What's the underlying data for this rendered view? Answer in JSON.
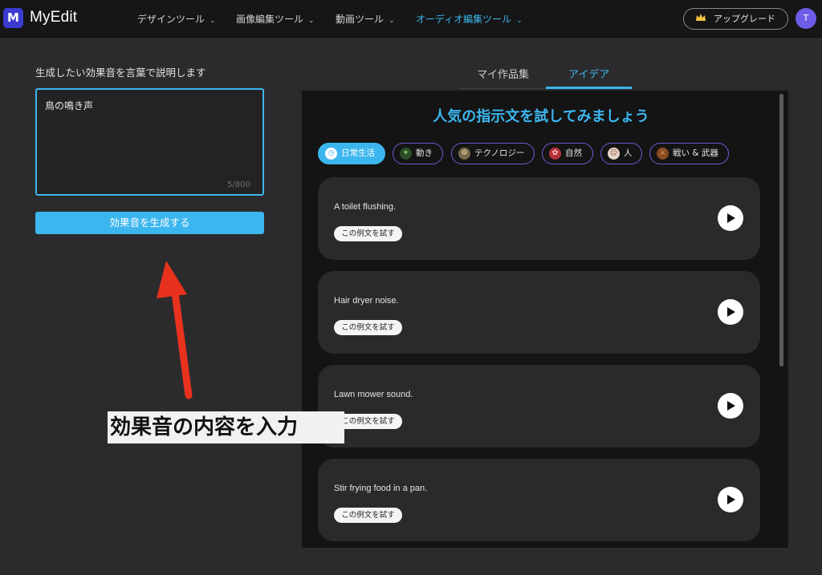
{
  "header": {
    "brand": "MyEdit",
    "nav": [
      {
        "label": "デザインツール"
      },
      {
        "label": "画像編集ツール"
      },
      {
        "label": "動画ツール"
      },
      {
        "label": "オーディオ編集ツール"
      }
    ],
    "upgrade_label": "アップグレード",
    "avatar_initial": "T",
    "logo_letter": "M"
  },
  "left": {
    "prompt_label": "生成したい効果音を言葉で説明します",
    "textarea_value": "鳥の鳴き声",
    "char_counter": "5/800",
    "generate_label": "効果音を生成する"
  },
  "annotation": {
    "caption": "効果音の内容を入力"
  },
  "tabs": [
    {
      "label": "マイ作品集"
    },
    {
      "label": "アイデア"
    }
  ],
  "ideas": {
    "title": "人気の指示文を試してみましょう",
    "categories": [
      {
        "label": "日常生活",
        "icon": "clock-icon"
      },
      {
        "label": "動き",
        "icon": "comet-icon"
      },
      {
        "label": "テクノロジー",
        "icon": "chip-icon"
      },
      {
        "label": "自然",
        "icon": "flower-icon"
      },
      {
        "label": "人",
        "icon": "person-icon"
      },
      {
        "label": "戦い & 武器",
        "icon": "weapons-icon"
      }
    ],
    "try_label": "この例文を試す",
    "cards": [
      {
        "text": "A toilet flushing."
      },
      {
        "text": "Hair dryer noise."
      },
      {
        "text": "Lawn mower sound."
      },
      {
        "text": "Stir frying food in a pan."
      }
    ]
  },
  "colors": {
    "accent": "#3cb6ee",
    "background": "#2b2b2d",
    "panel": "#141414",
    "card": "#2a2a2c",
    "annotation_arrow": "#e8321e",
    "category_border": "#6f5bd6"
  }
}
